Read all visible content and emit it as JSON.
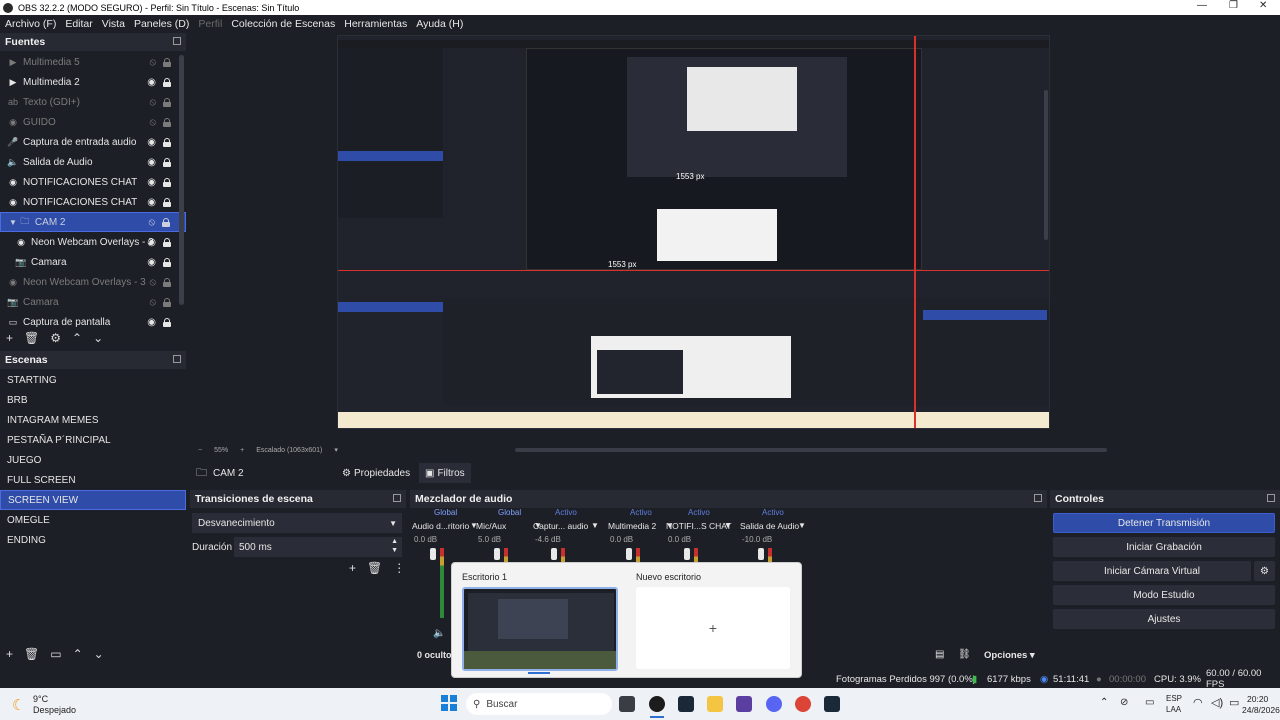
{
  "window": {
    "title": "OBS 32.2.2 (MODO SEGURO) - Perfil: Sin Título - Escenas: Sin Título"
  },
  "menu": {
    "items": [
      "Archivo (F)",
      "Editar",
      "Vista",
      "Paneles (D)",
      "Perfil",
      "Colección de Escenas",
      "Herramientas",
      "Ayuda (H)"
    ]
  },
  "sources": {
    "title": "Fuentes",
    "items": [
      {
        "label": "Multimedia 5",
        "icon": "play-icon",
        "visible": false
      },
      {
        "label": "Multimedia 2",
        "icon": "play-icon",
        "visible": true
      },
      {
        "label": "Texto (GDI+)",
        "icon": "text-icon",
        "visible": false
      },
      {
        "label": "GUIDO",
        "icon": "obs-icon",
        "visible": false
      },
      {
        "label": "Captura de entrada audio",
        "icon": "mic-icon",
        "visible": true
      },
      {
        "label": "Salida de Audio",
        "icon": "speaker-icon",
        "visible": true
      },
      {
        "label": "NOTIFICACIONES CHAT",
        "icon": "obs-icon",
        "visible": true
      },
      {
        "label": "NOTIFICACIONES CHAT",
        "icon": "obs-icon",
        "visible": true
      },
      {
        "label": "CAM 2",
        "icon": "folder-icon",
        "visible": false,
        "selected": true
      },
      {
        "label": "Neon Webcam Overlays - 3",
        "icon": "obs-icon",
        "visible": true,
        "child": true
      },
      {
        "label": "Camara",
        "icon": "camera-icon",
        "visible": true,
        "child": true
      },
      {
        "label": "Neon Webcam Overlays - 3",
        "icon": "obs-icon",
        "visible": false
      },
      {
        "label": "Camara",
        "icon": "camera-icon",
        "visible": false
      },
      {
        "label": "Captura de pantalla",
        "icon": "monitor-icon",
        "visible": true
      }
    ]
  },
  "scenes": {
    "title": "Escenas",
    "items": [
      "STARTING",
      "BRB",
      "INTAGRAM MEMES",
      "PESTAÑA P´RINCIPAL",
      "JUEGO",
      "FULL SCREEN",
      "SCREEN VIEW",
      "OMEGLE",
      "ENDING"
    ],
    "selected": "SCREEN VIEW"
  },
  "preview": {
    "zoom": "55%",
    "scale": "Escalado (1063x601)",
    "dim_top": "1553 px",
    "dim_bottom": "1553 px"
  },
  "context": {
    "source_name": "CAM 2",
    "properties": "Propiedades",
    "filters": "Filtros"
  },
  "transitions": {
    "title": "Transiciones de escena",
    "type": "Desvanecimiento",
    "duration_label": "Duración",
    "duration": "500 ms"
  },
  "mixer": {
    "title": "Mezclador de audio",
    "channels": [
      {
        "tag": "Global",
        "name": "Audio d...ritorio",
        "db": "0.0 dB"
      },
      {
        "tag": "Global",
        "name": "Mic/Aux",
        "db": "5.0 dB"
      },
      {
        "tag": "Activo",
        "name": "Captur... audio",
        "db": "-4.6 dB"
      },
      {
        "tag": "Activo",
        "name": "Multimedia 2",
        "db": "0.0 dB"
      },
      {
        "tag": "Activo",
        "name": "NOTIFI...S CHAT",
        "db": "0.0 dB"
      },
      {
        "tag": "Activo",
        "name": "Salida de Audio",
        "db": "-10.0 dB"
      }
    ],
    "hidden": "0 oculto",
    "options": "Opciones"
  },
  "controls": {
    "title": "Controles",
    "stop_stream": "Detener Transmisión",
    "start_recording": "Iniciar Grabación",
    "virtual_cam": "Iniciar Cámara Virtual",
    "studio_mode": "Modo Estudio",
    "settings": "Ajustes"
  },
  "status": {
    "dropped": "Fotogramas Perdidos 997 (0.0%)",
    "bitrate": "6177 kbps",
    "stream_time": "51:11:41",
    "rec_time": "00:00:00",
    "cpu": "CPU: 3.9%",
    "fps": "60.00 / 60.00 FPS"
  },
  "taskview": {
    "desktop1": "Escritorio 1",
    "new_desktop": "Nuevo escritorio",
    "plus": "+"
  },
  "taskbar": {
    "temp": "9°C",
    "weather": "Despejado",
    "search": "Buscar",
    "lang1": "ESP",
    "lang2": "LAA",
    "time": "20:20",
    "date": "24/8/2026"
  },
  "colors": {
    "accent": "#2f4da8",
    "bg": "#1d1f26",
    "tally_red": "#d9302c"
  }
}
